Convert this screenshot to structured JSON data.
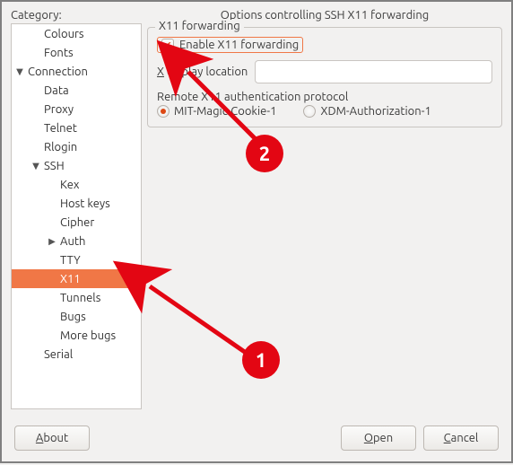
{
  "category_label": "Category:",
  "panel_title": "Options controlling SSH X11 forwarding",
  "group_label": "X11 forwarding",
  "checkbox_label": "Enable X11 forwarding",
  "checkbox_checked": true,
  "display_label_pre": "X",
  "display_label_mid": " display location",
  "display_value": "",
  "auth_label": "Remote X11 authentication protocol",
  "radio_mit": "MIT-Magic-Cookie-1",
  "radio_xdm": "XDM-Authorization-1",
  "buttons": {
    "about": "About",
    "open": "Open",
    "cancel": "Cancel"
  },
  "tree": [
    {
      "label": "Colours",
      "depth": 2,
      "arrow": ""
    },
    {
      "label": "Fonts",
      "depth": 2,
      "arrow": ""
    },
    {
      "label": "Connection",
      "depth": 1,
      "arrow": "down"
    },
    {
      "label": "Data",
      "depth": 2,
      "arrow": ""
    },
    {
      "label": "Proxy",
      "depth": 2,
      "arrow": ""
    },
    {
      "label": "Telnet",
      "depth": 2,
      "arrow": ""
    },
    {
      "label": "Rlogin",
      "depth": 2,
      "arrow": ""
    },
    {
      "label": "SSH",
      "depth": 2,
      "arrow": "down"
    },
    {
      "label": "Kex",
      "depth": 3,
      "arrow": ""
    },
    {
      "label": "Host keys",
      "depth": 3,
      "arrow": ""
    },
    {
      "label": "Cipher",
      "depth": 3,
      "arrow": ""
    },
    {
      "label": "Auth",
      "depth": 3,
      "arrow": "right"
    },
    {
      "label": "TTY",
      "depth": 3,
      "arrow": ""
    },
    {
      "label": "X11",
      "depth": 3,
      "arrow": "",
      "selected": true
    },
    {
      "label": "Tunnels",
      "depth": 3,
      "arrow": ""
    },
    {
      "label": "Bugs",
      "depth": 3,
      "arrow": ""
    },
    {
      "label": "More bugs",
      "depth": 3,
      "arrow": ""
    },
    {
      "label": "Serial",
      "depth": 2,
      "arrow": ""
    }
  ],
  "annotations": {
    "badge1": "1",
    "badge2": "2"
  }
}
